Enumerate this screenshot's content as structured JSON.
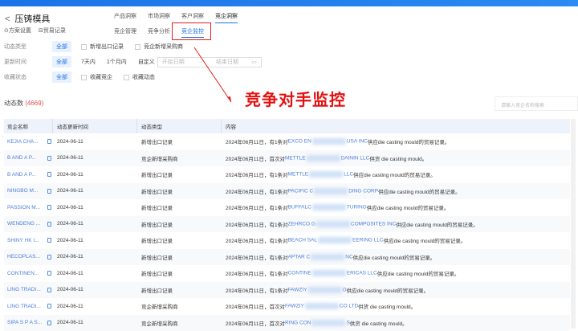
{
  "header": {
    "title": "压铸模具",
    "back": "<",
    "settings": "⊙方案设置",
    "trade_records": "⊟贸易记录"
  },
  "tabs": [
    "产品洞察",
    "市场洞察",
    "客户洞察",
    "竞企洞察"
  ],
  "subtabs": [
    "竞企管理",
    "竞争分析",
    "竞企监控"
  ],
  "filters": {
    "type": {
      "label": "动态类型",
      "all": "全部",
      "options": [
        "新增出口记录",
        "竞企新增采购商"
      ]
    },
    "time": {
      "label": "更新时间",
      "all": "全部",
      "options": [
        "7天内",
        "1个月内",
        "自定义"
      ],
      "start_placeholder": "开始日期",
      "sep": "→",
      "end_placeholder": "结束日期"
    },
    "fav": {
      "label": "收藏状态",
      "all": "全部",
      "options": [
        "收藏竞企",
        "收藏动态"
      ]
    }
  },
  "annotation": "竞争对手监控",
  "summary": {
    "label": "动态数",
    "count": "(4669)"
  },
  "search": {
    "placeholder": "请输入竞企名称搜索"
  },
  "table": {
    "headers": [
      "竞企名称",
      "动态更新时间",
      "动态类型",
      "内容"
    ],
    "rows": [
      {
        "name": "KEJIA CHA...",
        "date": "2024-06-11",
        "type": "新增出口记录",
        "pre": "2024年06月11日，有1条对",
        "co1": "EXCO EN",
        "co2": "USA INC",
        "post": "供应die casting mould的贸易记录。"
      },
      {
        "name": "B AND A P...",
        "date": "2024-06-11",
        "type": "竞企新增采购商",
        "pre": "2024年06月11日，首次对 ",
        "co1": "METTLE",
        "co2": "DAININ LLC",
        "post": " 供货 die casting mould。"
      },
      {
        "name": "B AND A P...",
        "date": "2024-06-11",
        "type": "新增出口记录",
        "pre": "2024年06月11日，有1条对",
        "co1": "METTLE",
        "co2": "LLC",
        "post": "供应die casting mould的贸易记录。"
      },
      {
        "name": "NINGBO M...",
        "date": "2024-06-11",
        "type": "新增出口记录",
        "pre": "2024年06月11日，有1条对",
        "co1": "PACIFIC C",
        "co2": "DING CORP",
        "post": "供应die casting mould的贸易记录。"
      },
      {
        "name": "PASSION M...",
        "date": "2024-06-11",
        "type": "新增出口记录",
        "pre": "2024年06月11日，有1条对",
        "co1": "BUFFALC",
        "co2": "TURING",
        "post": "供应die casting mould的贸易记录。"
      },
      {
        "name": "WENDENG ...",
        "date": "2024-06-11",
        "type": "新增出口记录",
        "pre": "2024年06月11日，有1条对",
        "co1": "ZEHRCO G",
        "co2": "COMPOSITES INC",
        "post": "供应die casting mould的贸易记录。"
      },
      {
        "name": "SHINY HK I...",
        "date": "2024-06-11",
        "type": "新增出口记录",
        "pre": "2024年06月11日，有1条对",
        "co1": "BEACH SAL",
        "co2": "EERING LLC",
        "post": "供应die casting mould的贸易记录。"
      },
      {
        "name": "HECOPLAS...",
        "date": "2024-06-11",
        "type": "新增出口记录",
        "pre": "2024年06月11日，有1条对",
        "co1": "APTAR C",
        "co2": "NC",
        "post": "供应die casting mould的贸易记录。"
      },
      {
        "name": "CONTINEN...",
        "date": "2024-06-11",
        "type": "新增出口记录",
        "pre": "2024年06月11日，有1条对",
        "co1": "CONTINE",
        "co2": "ERICAS LLC",
        "post": "供应die casting mould的贸易记录。"
      },
      {
        "name": "LING TRADI...",
        "date": "2024-06-11",
        "type": "新增出口记录",
        "pre": "2024年06月11日，有1条对",
        "co1": "FAWZIY",
        "co2": "O",
        "post": "供应die casting mould的贸易记录。"
      },
      {
        "name": "LING TRADI...",
        "date": "2024-06-11",
        "type": "竞企新增采购商",
        "pre": "2024年06月11日，首次对 ",
        "co1": "FAWZIY",
        "co2": "CO LTD",
        "post": " 供货 die casting mould。"
      },
      {
        "name": "SIPA S P A S...",
        "date": "2024-06-11",
        "type": "竞企新增采购商",
        "pre": "2024年06月11日，首次对 ",
        "co1": "RING CON",
        "co2": "S",
        "post": " 供货 die casting mould。"
      }
    ]
  },
  "colors": {
    "accent": "#1a73e8",
    "annotation": "#e41111"
  }
}
